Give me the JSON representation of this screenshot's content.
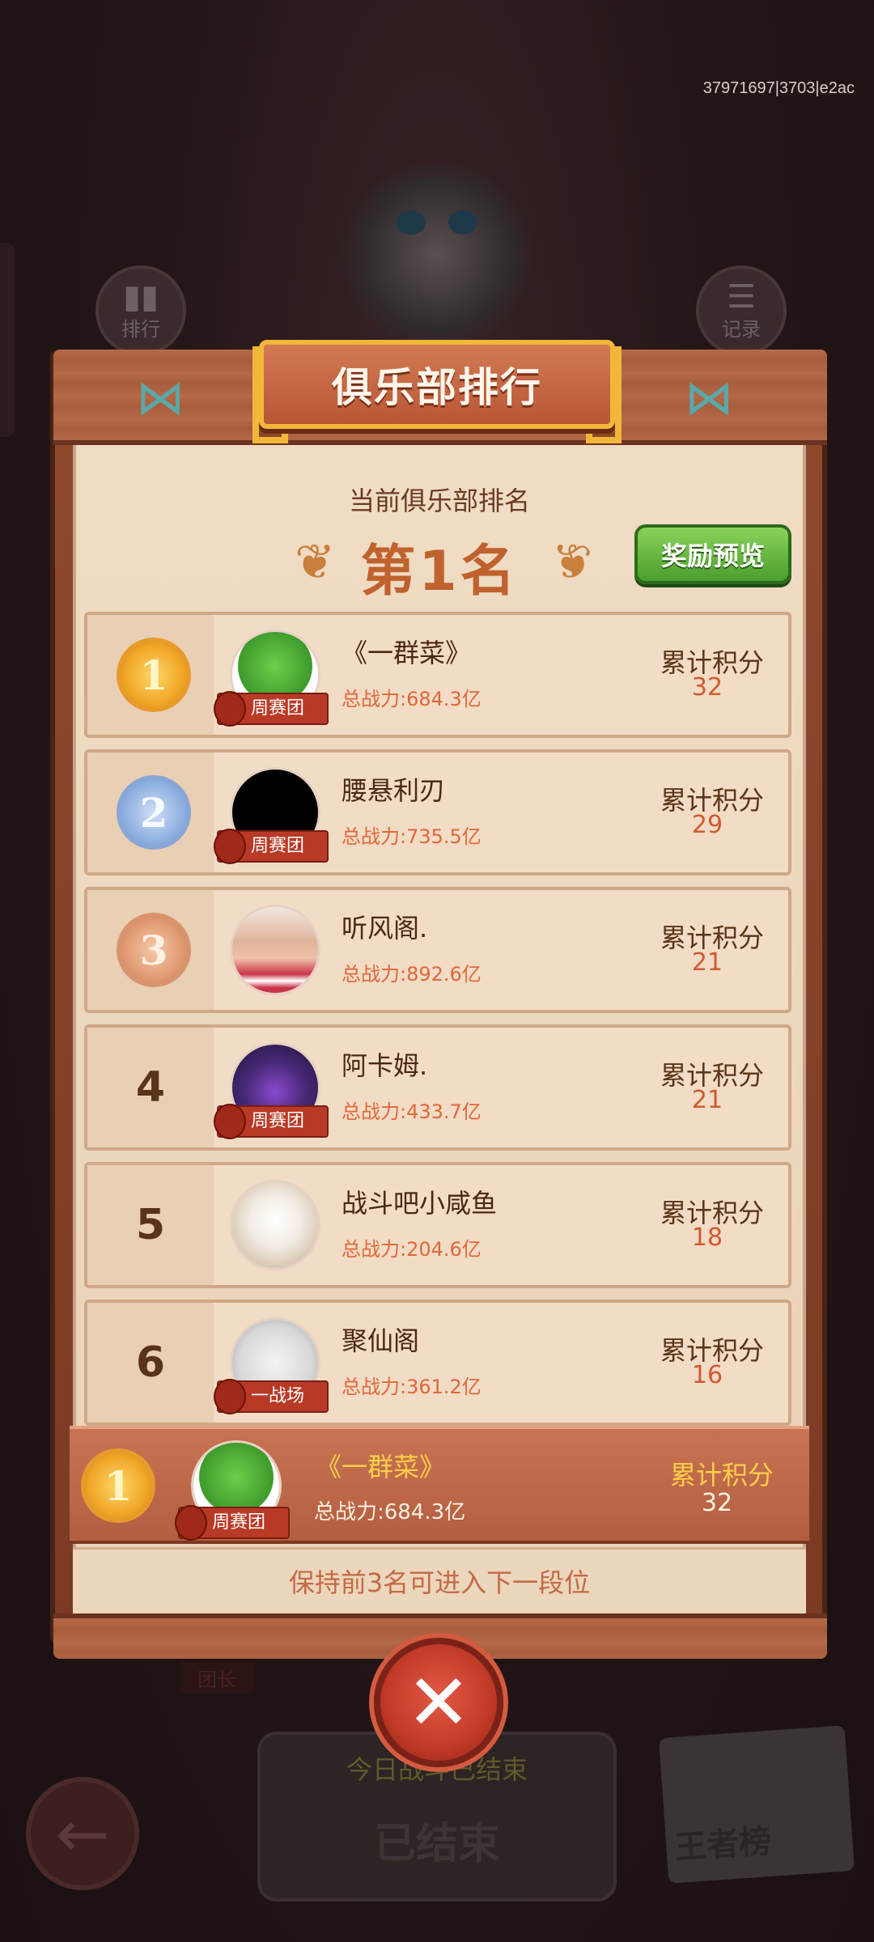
{
  "build_id": "37971697|3703|e2ac",
  "background": {
    "left_button_label": "排行",
    "right_button_label": "记录",
    "captain_label": "团长",
    "ended_notice": "今日战斗已结束",
    "ended_button": "已结束",
    "king_list_label": "王者榜"
  },
  "panel": {
    "title": "俱乐部排行",
    "subtitle": "当前俱乐部排名",
    "current_rank": "第1名",
    "reward_preview_button": "奖励预览"
  },
  "rows": [
    {
      "rank": "1",
      "medal": "gold",
      "name": "《一群菜》",
      "power": "总战力:684.3亿",
      "score_label": "累计积分",
      "score": "32",
      "tag": "周赛团",
      "avatar_color": "#4caf3a"
    },
    {
      "rank": "2",
      "medal": "silver",
      "name": "腰悬利刃",
      "power": "总战力:735.5亿",
      "score_label": "累计积分",
      "score": "29",
      "tag": "周赛团",
      "avatar_color": "#000000"
    },
    {
      "rank": "3",
      "medal": "bronze",
      "name": "听风阁.",
      "power": "总战力:892.6亿",
      "score_label": "累计积分",
      "score": "21",
      "tag": "",
      "avatar_color": "#d9a48a"
    },
    {
      "rank": "4",
      "medal": "",
      "name": "阿卡姆.",
      "power": "总战力:433.7亿",
      "score_label": "累计积分",
      "score": "21",
      "tag": "周赛团",
      "avatar_color": "#4a2a7a"
    },
    {
      "rank": "5",
      "medal": "",
      "name": "战斗吧小咸鱼",
      "power": "总战力:204.6亿",
      "score_label": "累计积分",
      "score": "18",
      "tag": "",
      "avatar_color": "#efe6da"
    },
    {
      "rank": "6",
      "medal": "",
      "name": "聚仙阁",
      "power": "总战力:361.2亿",
      "score_label": "累计积分",
      "score": "16",
      "tag": "一战场",
      "avatar_color": "#dcdcdc"
    }
  ],
  "my_club": {
    "rank": "1",
    "name": "《一群菜》",
    "power": "总战力:684.3亿",
    "score_label": "累计积分",
    "score": "32",
    "tag": "周赛团"
  },
  "keep_note": "保持前3名可进入下一段位",
  "close_icon": "close-x-icon"
}
